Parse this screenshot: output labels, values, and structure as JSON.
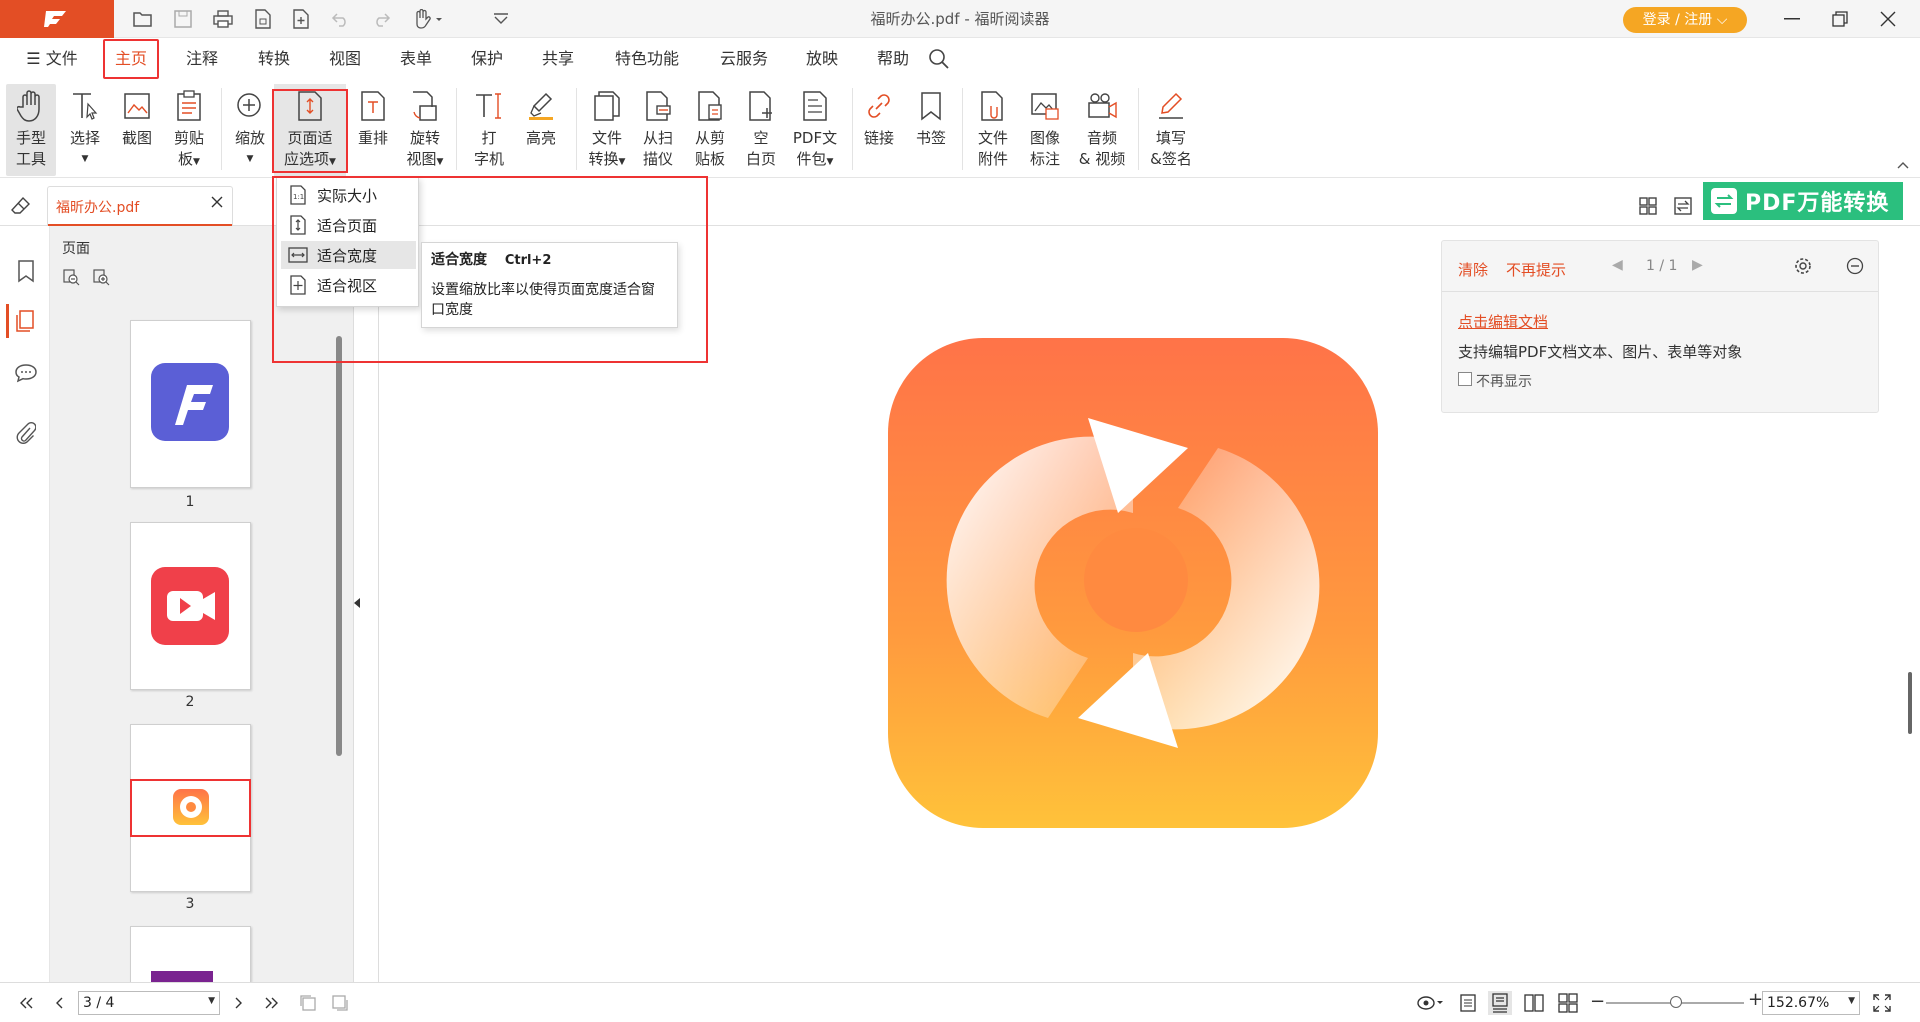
{
  "window": {
    "title": "福昕办公.pdf - 福昕阅读器",
    "login_label": "登录 / 注册"
  },
  "menu": {
    "file": "文件",
    "items": [
      "主页",
      "注释",
      "转换",
      "视图",
      "表单",
      "保护",
      "共享",
      "特色功能",
      "云服务",
      "放映",
      "帮助"
    ]
  },
  "ribbon": {
    "hand": [
      "手型",
      "工具"
    ],
    "select": [
      "选择",
      ""
    ],
    "screenshot": "截图",
    "clipboard": [
      "剪贴",
      "板"
    ],
    "zoom": "缩放",
    "page_fit": [
      "页面适",
      "应选项"
    ],
    "reflow": "重排",
    "rotate": [
      "旋转",
      "视图"
    ],
    "typewriter": [
      "打",
      "字机"
    ],
    "highlight": "高亮",
    "file_convert": [
      "文件",
      "转换"
    ],
    "from_scanner": [
      "从扫",
      "描仪"
    ],
    "from_clipboard": [
      "从剪",
      "贴板"
    ],
    "blank_page": [
      "空",
      "白页"
    ],
    "pdf_package": [
      "PDF文",
      "件包"
    ],
    "link": "链接",
    "bookmark": "书签",
    "file_attach": [
      "文件",
      "附件"
    ],
    "image_annot": [
      "图像",
      "标注"
    ],
    "audio_video": [
      "音频",
      "& 视频"
    ],
    "fill_sign": [
      "填写",
      "&签名"
    ]
  },
  "doc_tab": {
    "name": "福昕办公.pdf"
  },
  "pdf_convert_banner": "PDF万能转换",
  "thumbnails": {
    "header": "页面",
    "pages": [
      {
        "num": "1"
      },
      {
        "num": "2"
      },
      {
        "num": "3"
      }
    ]
  },
  "dropdown": {
    "items": [
      "实际大小",
      "适合页面",
      "适合宽度",
      "适合视区"
    ]
  },
  "tooltip": {
    "title": "适合宽度",
    "shortcut": "Ctrl+2",
    "desc": "设置缩放比率以使得页面宽度适合窗口宽度"
  },
  "notice": {
    "clear": "清除",
    "no_more": "不再提示",
    "page": "1 / 1",
    "link": "点击编辑文档",
    "desc": "支持编辑PDF文档文本、图片、表单等对象",
    "checkbox": "不再显示"
  },
  "status": {
    "page_input": "3 / 4",
    "zoom": "152.67%",
    "zoom_slider_fraction": 0.51
  },
  "colors": {
    "brand": "#e34e25",
    "accent_green": "#2bbf7e",
    "login": "#f5a623"
  }
}
